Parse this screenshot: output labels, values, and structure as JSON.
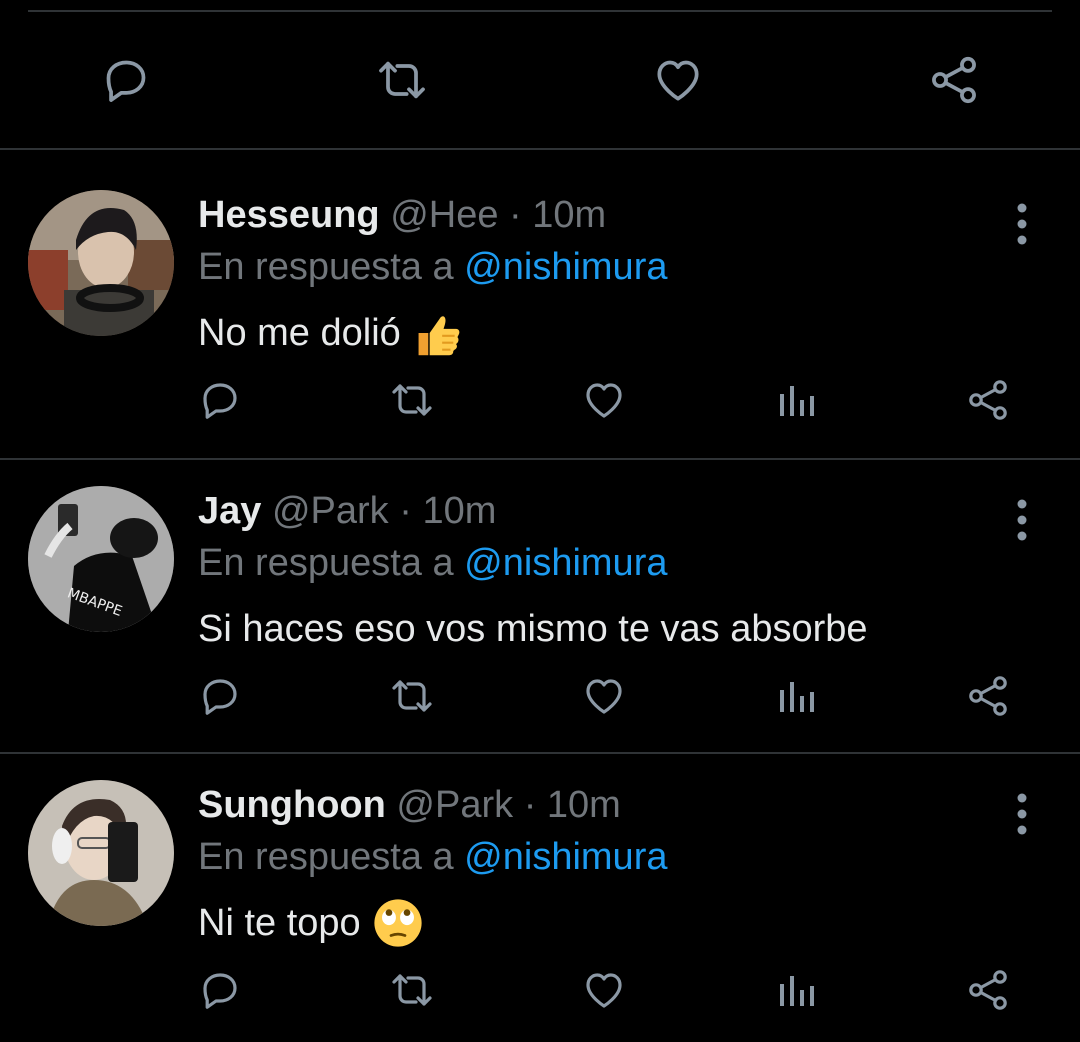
{
  "colors": {
    "background": "#000000",
    "divider": "#2f3336",
    "text": "#e7e9ea",
    "secondary": "#71767b",
    "accent": "#1d9bf0"
  },
  "main_actions": [
    "reply-icon",
    "retweet-icon",
    "like-icon",
    "share-icon"
  ],
  "reply_actions": [
    "reply-icon",
    "retweet-icon",
    "like-icon",
    "analytics-icon",
    "share-icon"
  ],
  "replies": [
    {
      "name": "Hesseung",
      "handle": "@Hee",
      "time": "· 10m",
      "reply_prefix": "En respuesta a",
      "mention": "@nishimura",
      "text": "No me dolió",
      "emoji": "thumbs-up-emoji"
    },
    {
      "name": "Jay",
      "handle": "@Park",
      "time": "· 10m",
      "reply_prefix": "En respuesta a",
      "mention": "@nishimura",
      "text": "Si haces eso vos mismo te vas absorbe",
      "emoji": ""
    },
    {
      "name": "Sunghoon",
      "handle": "@Park",
      "time": "· 10m",
      "reply_prefix": "En respuesta a",
      "mention": "@nishimura",
      "text": "Ni te topo",
      "emoji": "eye-roll-emoji"
    }
  ]
}
